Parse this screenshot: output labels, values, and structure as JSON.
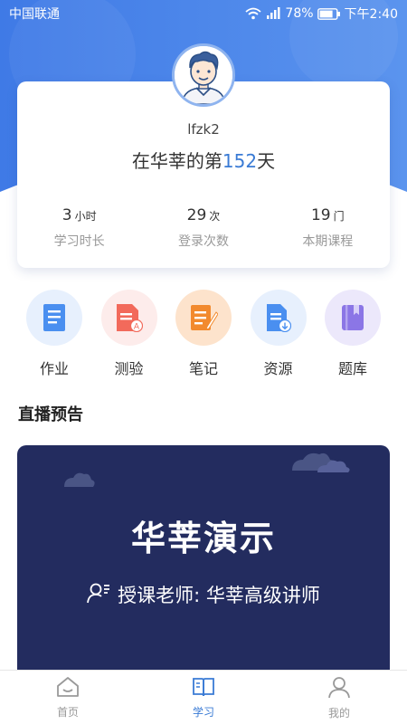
{
  "status_bar": {
    "carrier": "中国联通",
    "battery": "78%",
    "time": "下午2:40"
  },
  "profile": {
    "username": "lfzk2",
    "days_prefix": "在华莘的第",
    "days_count": "152",
    "days_suffix": "天"
  },
  "stats": [
    {
      "value": "3",
      "unit": "小时",
      "label": "学习时长"
    },
    {
      "value": "29",
      "unit": "次",
      "label": "登录次数"
    },
    {
      "value": "19",
      "unit": "门",
      "label": "本期课程"
    }
  ],
  "shortcuts": [
    {
      "label": "作业",
      "icon": "homework-icon",
      "bg": "#e7f0fd",
      "color": "#4a8ff0"
    },
    {
      "label": "测验",
      "icon": "quiz-icon",
      "bg": "#fdeceb",
      "color": "#f26a5b"
    },
    {
      "label": "笔记",
      "icon": "notes-icon",
      "bg": "#fde3cc",
      "color": "#f28a2e"
    },
    {
      "label": "资源",
      "icon": "resources-icon",
      "bg": "#e7f0fd",
      "color": "#4a8ff0"
    },
    {
      "label": "题库",
      "icon": "question-bank-icon",
      "bg": "#ece8fb",
      "color": "#8b76e6"
    }
  ],
  "live_section": {
    "title": "直播预告",
    "card_title": "华莘演示",
    "teacher": "授课老师: 华莘高级讲师"
  },
  "bottom_nav": [
    {
      "label": "首页",
      "icon": "home-icon",
      "active": false
    },
    {
      "label": "学习",
      "icon": "study-book-icon",
      "active": true
    },
    {
      "label": "我的",
      "icon": "profile-icon",
      "active": false
    }
  ],
  "colors": {
    "accent": "#3a7bd5",
    "hero_blue": "#4d86e8",
    "live_card": "#232c5f"
  }
}
